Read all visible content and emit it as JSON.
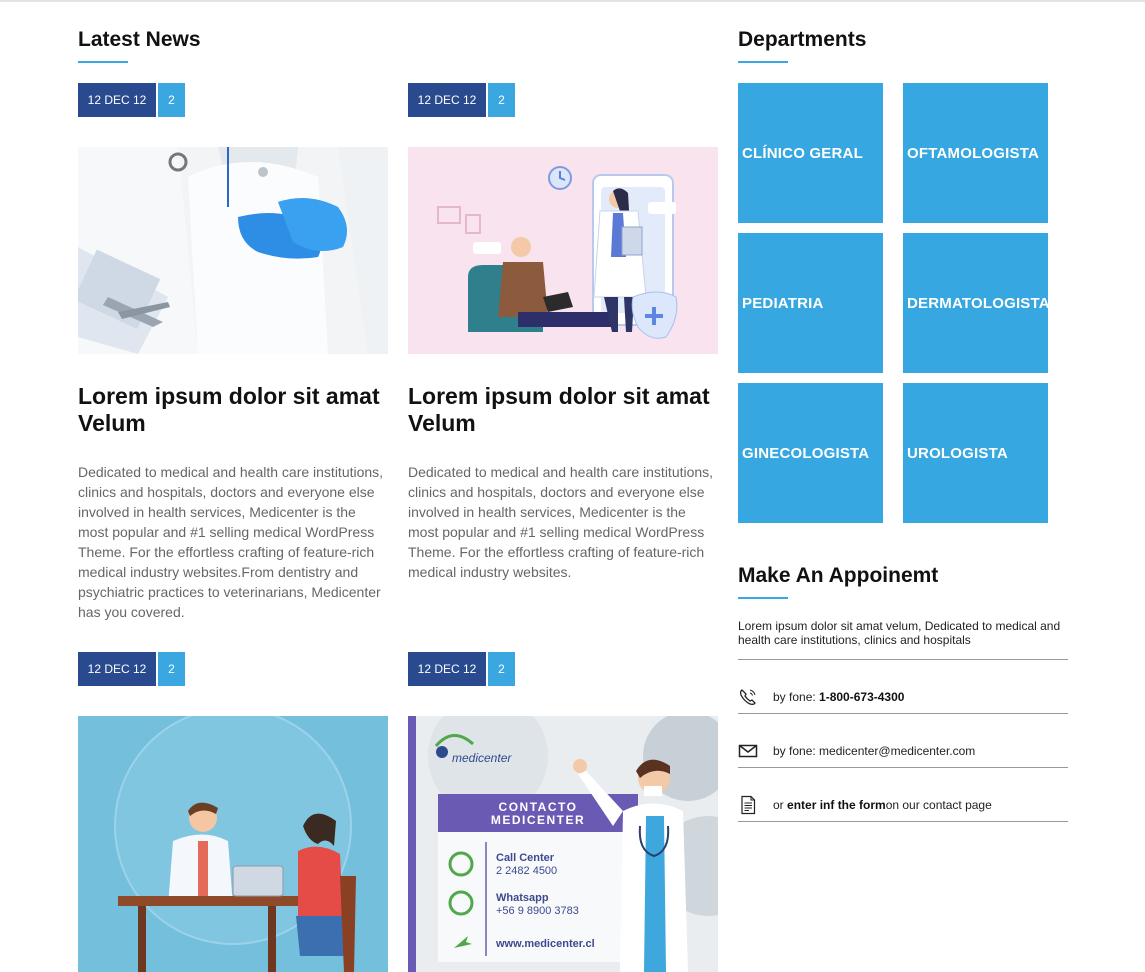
{
  "news": {
    "title": "Latest News",
    "items": [
      {
        "date": "12 DEC 12",
        "count": "2",
        "title": "Lorem ipsum dolor sit amat Velum",
        "text": "Dedicated to medical and health care institutions, clinics and hospitals, doctors and everyone else involved in health services, Medicenter is the most popular and #1 selling medical WordPress Theme. For the effortless crafting of feature-rich medical industry websites.From dentistry and psychiatric practices to veterinarians, Medicenter has you covered."
      },
      {
        "date": "12 DEC 12",
        "count": "2",
        "title": "Lorem ipsum dolor sit amat Velum",
        "text": "Dedicated to medical and health care institutions, clinics and hospitals, doctors and everyone else involved in health services, Medicenter is the most popular and #1 selling medical WordPress Theme. For the effortless crafting of feature-rich medical industry websites."
      },
      {
        "date": "12 DEC 12",
        "count": "2"
      },
      {
        "date": "12 DEC 12",
        "count": "2"
      }
    ],
    "contact_image": {
      "brand": "medicenter",
      "heading_line1": "CONTACTO",
      "heading_line2": "MEDICENTER",
      "call_label": "Call Center",
      "call_number": "2 2482 4500",
      "whatsapp_label": "Whatsapp",
      "whatsapp_number": "+56 9 8900 3783",
      "website": "www.medicenter.cl"
    }
  },
  "departments": {
    "title": "Departments",
    "items": [
      "CLÍNICO GERAL",
      "OFTAMOLOGISTA",
      "PEDIATRIA",
      "DERMATOLOGISTA",
      "GINECOLOGISTA",
      "UROLOGISTA"
    ]
  },
  "appointment": {
    "title": "Make An Appoinemt",
    "description": "Lorem ipsum dolor sit amat velum, Dedicated to medical and health care institutions, clinics and hospitals",
    "phone_prefix": "by fone: ",
    "phone": "1-800-673-4300",
    "email_prefix": "by fone: ",
    "email": "medicenter@medicenter.com",
    "form_prefix": "or ",
    "form_link": "enter inf the form",
    "form_suffix": "on our contact page"
  },
  "colors": {
    "accent": "#36a7e0",
    "date_badge": "#2a4a8f"
  }
}
